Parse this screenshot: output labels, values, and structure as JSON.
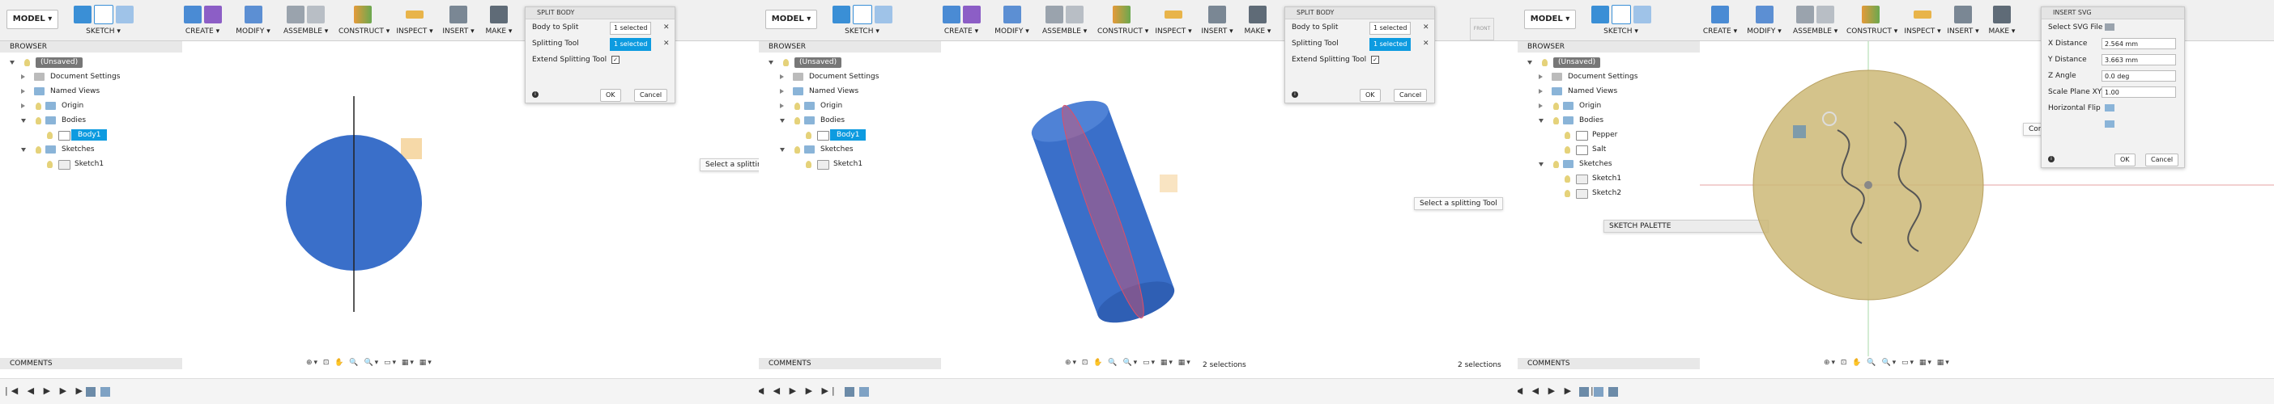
{
  "shared": {
    "model": "MODEL ▾",
    "browser": "BROWSER",
    "comments": "COMMENTS",
    "tools": {
      "sketch": "SKETCH ▾",
      "create": "CREATE ▾",
      "modify": "MODIFY ▾",
      "assemble": "ASSEMBLE ▾",
      "construct": "CONSTRUCT ▾",
      "inspect": "INSPECT ▾",
      "insert": "INSERT ▾",
      "make": "MAKE ▾"
    },
    "tree": {
      "unsaved": "(Unsaved)",
      "document_settings": "Document Settings",
      "named_views": "Named Views",
      "origin": "Origin",
      "bodies": "Bodies",
      "body1": "Body1",
      "sketches": "Sketches",
      "sketch1": "Sketch1",
      "sketch2": "Sketch2",
      "pepper": "Pepper",
      "salt": "Salt"
    },
    "viewcube_front": "FRONT",
    "navbar_glyphs": "⊕▾ ⊡ ✋ 🔍 🔍▾ ▭▾ ▦▾ ▦▾",
    "timeline_glyphs": "|◀ ◀ ▶ ▶ ▶|"
  },
  "split_body": {
    "title": "SPLIT BODY",
    "body_to_split": "Body to Split",
    "splitting_tool": "Splitting Tool",
    "extend_splitting_tool": "Extend Splitting Tool",
    "selected": "1 selected",
    "ok": "OK",
    "cancel": "Cancel",
    "checked": "✓"
  },
  "panel1": {
    "tooltip": "Select a splittin"
  },
  "panel2": {
    "tooltip": "Select a splitting Tool",
    "selections": "2 selections"
  },
  "panel3": {
    "selections": "2 selections",
    "sketch_palette": "SKETCH PALETTE",
    "concentric_tooltip": "Concentric To",
    "insert_svg": {
      "title": "INSERT SVG",
      "select_svg_file": "Select SVG File",
      "x_distance": "X Distance",
      "x_value": "2.564 mm",
      "y_distance": "Y Distance",
      "y_value": "3.663 mm",
      "z_angle": "Z Angle",
      "z_value": "0.0 deg",
      "scale_plane_xy": "Scale Plane XY",
      "scale_value": "1.00",
      "horizontal_flip": "Horizontal Flip",
      "ok": "OK",
      "cancel": "Cancel"
    }
  },
  "colors": {
    "accent": "#0d9be0",
    "body_blue": "#3a6fc9",
    "body_tan": "#cdb877",
    "split_red": "#d9506a"
  }
}
